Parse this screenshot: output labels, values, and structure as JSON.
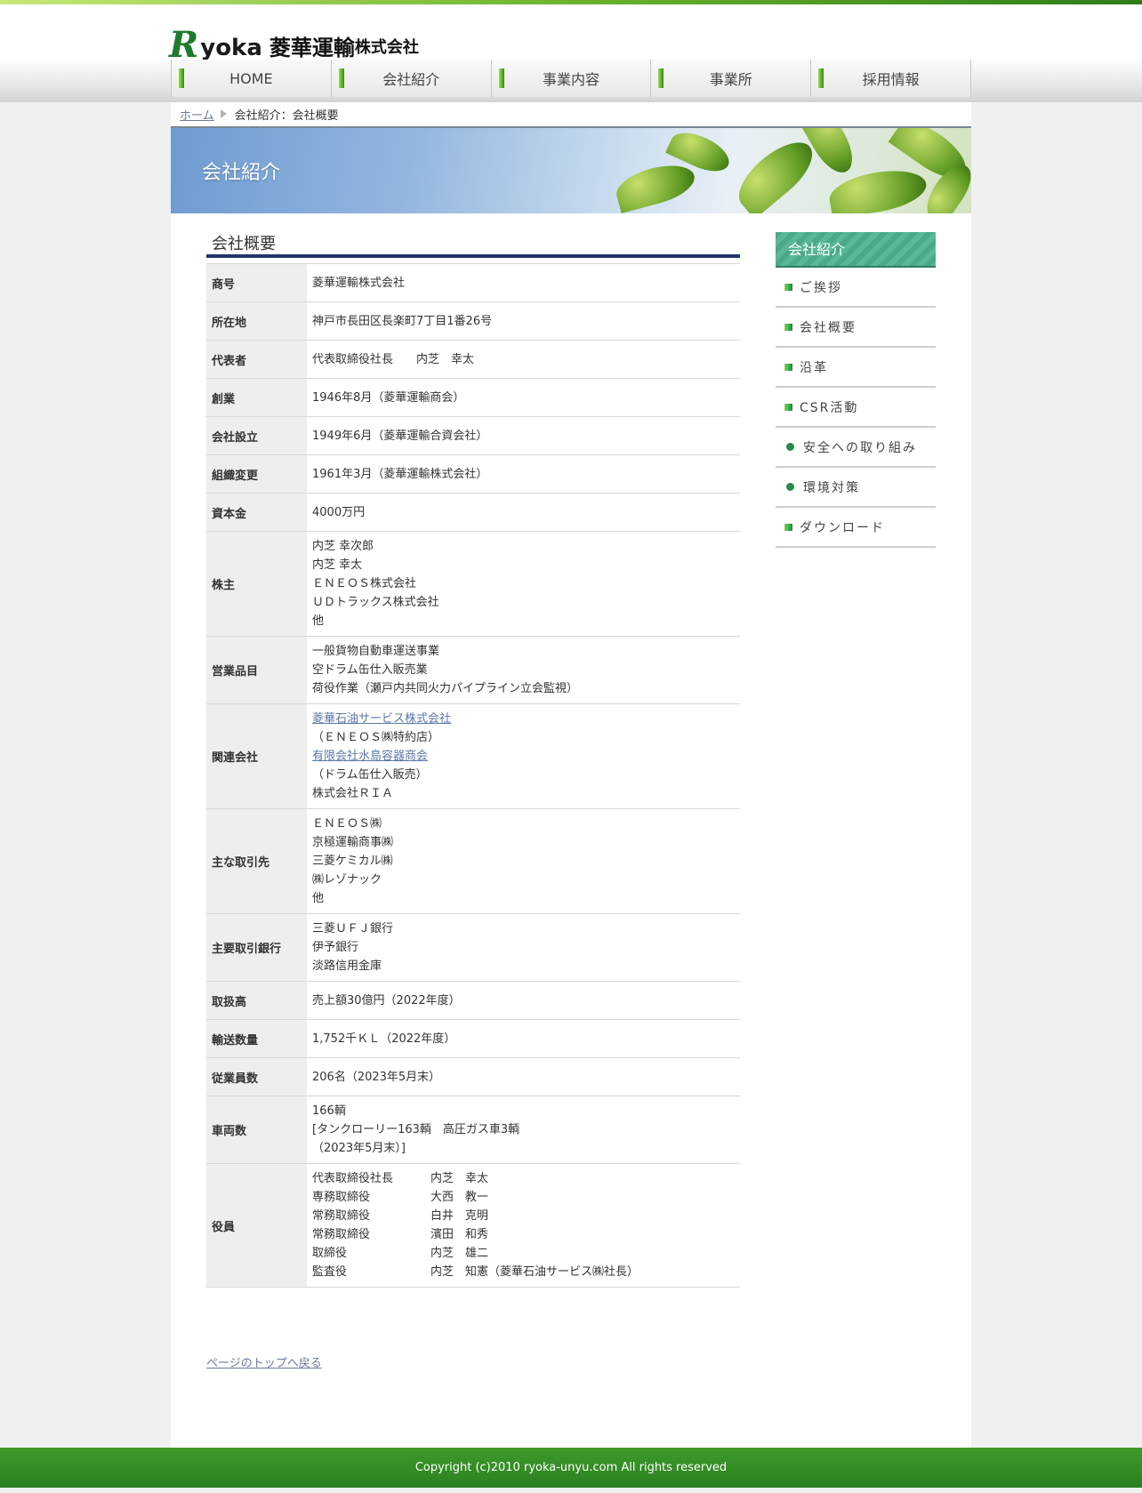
{
  "logo": {
    "mark": "R",
    "word": "yoka",
    "company": "菱華運輸",
    "suffix": "株式会社"
  },
  "nav": {
    "items": [
      "HOME",
      "会社紹介",
      "事業内容",
      "事業所",
      "採用情報"
    ]
  },
  "breadcrumb": {
    "home": "ホーム",
    "current": "会社紹介：会社概要"
  },
  "hero": {
    "title": "会社紹介"
  },
  "main": {
    "section_title": "会社概要",
    "rows": [
      {
        "label": "商号",
        "lines": [
          "菱華運輸株式会社"
        ]
      },
      {
        "label": "所在地",
        "lines": [
          "神戸市長田区長楽町7丁目1番26号"
        ]
      },
      {
        "label": "代表者",
        "lines": [
          "代表取締役社長　　内芝　幸太"
        ]
      },
      {
        "label": "創業",
        "lines": [
          "1946年8月（菱華運輸商会）"
        ]
      },
      {
        "label": "会社設立",
        "lines": [
          "1949年6月（菱華運輸合資会社）"
        ]
      },
      {
        "label": "組織変更",
        "lines": [
          "1961年3月（菱華運輸株式会社）"
        ]
      },
      {
        "label": "資本金",
        "lines": [
          "4000万円"
        ]
      },
      {
        "label": "株主",
        "lines": [
          "内芝 幸次郎",
          "内芝 幸太",
          "ＥＮＥＯＳ株式会社",
          "ＵＤトラックス株式会社",
          "他"
        ]
      },
      {
        "label": "営業品目",
        "lines": [
          "一般貨物自動車運送事業",
          "空ドラム缶仕入販売業",
          "荷役作業（瀬戸内共同火力パイプライン立会監視）"
        ]
      },
      {
        "label": "関連会社",
        "lines": [
          "菱華石油サービス株式会社",
          "（ＥＮＥＯＳ㈱特約店）",
          "有限会社水島容器商会",
          "（ドラム缶仕入販売）",
          "株式会社ＲＩＡ"
        ]
      },
      {
        "label": "主な取引先",
        "lines": [
          "ＥＮＥＯＳ㈱",
          "京極運輸商事㈱",
          "三菱ケミカル㈱",
          "㈱レゾナック",
          "他"
        ]
      },
      {
        "label": "主要取引銀行",
        "lines": [
          "三菱ＵＦＪ銀行",
          "伊予銀行",
          "淡路信用金庫"
        ]
      },
      {
        "label": "取扱高",
        "lines": [
          "売上額30億円（2022年度）"
        ]
      },
      {
        "label": "輸送数量",
        "lines": [
          "1,752千ＫＬ（2022年度）"
        ]
      },
      {
        "label": "従業員数",
        "lines": [
          "206名（2023年5月末）"
        ]
      },
      {
        "label": "車両数",
        "lines": [
          "166輌",
          "[タンクローリー163輌　高圧ガス車3輌",
          "（2023年5月末）]"
        ]
      }
    ],
    "officers_label": "役員",
    "officers": [
      {
        "role": "代表取締役社長",
        "name": "内芝　幸太"
      },
      {
        "role": "専務取締役",
        "name": "大西　教一"
      },
      {
        "role": "常務取締役",
        "name": "白井　克明"
      },
      {
        "role": "常務取締役",
        "name": "濱田　和秀"
      },
      {
        "role": "取締役",
        "name": "内芝　雄二"
      },
      {
        "role": "監査役",
        "name": "内芝　知憲（菱華石油サービス㈱社長）"
      }
    ],
    "back_to_top": "ページのトップへ戻る"
  },
  "sidebar": {
    "title": "会社紹介",
    "items": [
      {
        "label": "ご挨拶",
        "bullet": "square"
      },
      {
        "label": "会社概要",
        "bullet": "square"
      },
      {
        "label": "沿革",
        "bullet": "square"
      },
      {
        "label": "CSR活動",
        "bullet": "square"
      },
      {
        "label": "安全への取り組み",
        "bullet": "dot"
      },
      {
        "label": "環境対策",
        "bullet": "dot"
      },
      {
        "label": "ダウンロード",
        "bullet": "square"
      }
    ]
  },
  "footer": {
    "copyright": "Copyright (c)2010 ryoka-unyu.com All rights reserved"
  },
  "colors": {
    "brand_green": "#2a8020",
    "section_rule": "#22356b",
    "link": "#5a78a6",
    "sidebar_head": "#4aa98a"
  }
}
